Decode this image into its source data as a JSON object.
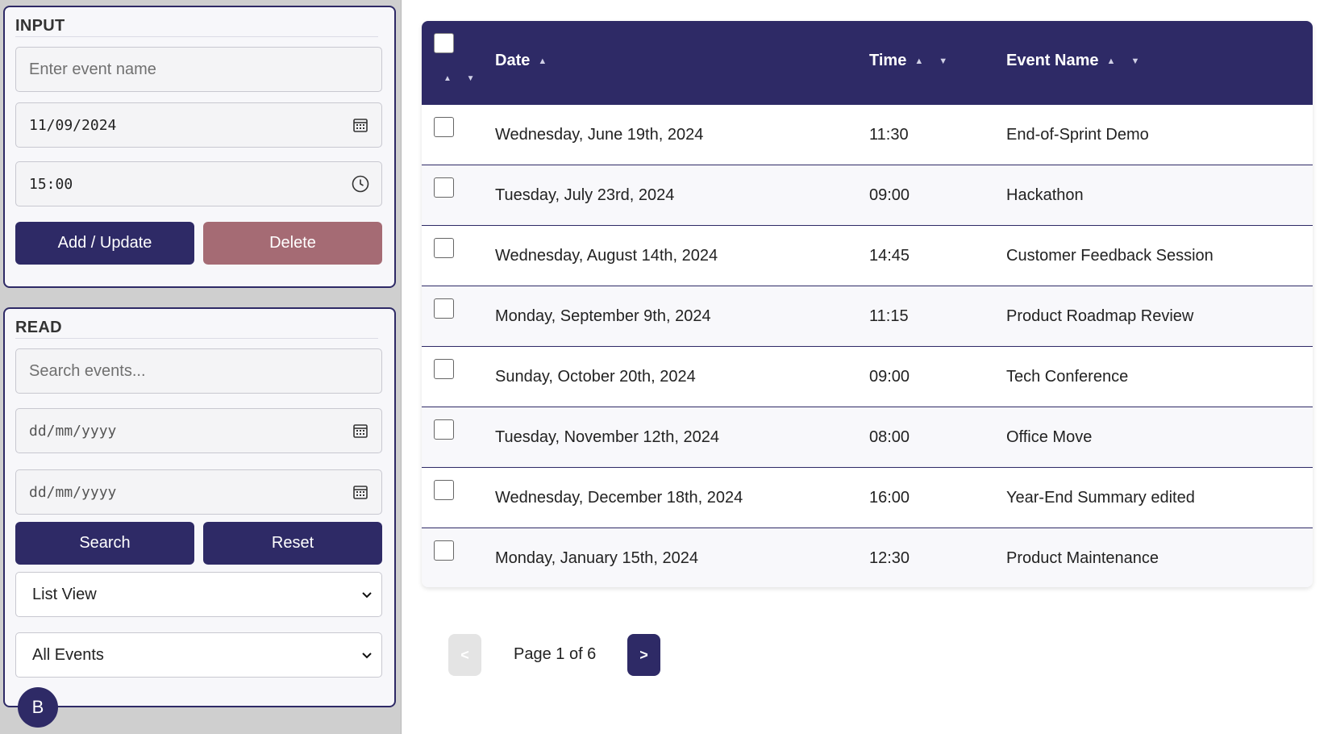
{
  "input": {
    "title": "INPUT",
    "event_name_placeholder": "Enter event name",
    "date_value": "11/09/2024",
    "time_value": "15:00",
    "add_update_label": "Add / Update",
    "delete_label": "Delete"
  },
  "read": {
    "title": "READ",
    "search_placeholder": "Search events...",
    "from_date_placeholder": "dd/mm/yyyy",
    "to_date_placeholder": "dd/mm/yyyy",
    "search_label": "Search",
    "reset_label": "Reset",
    "view_select": "List View",
    "filter_select": "All Events"
  },
  "avatar": {
    "initial": "B"
  },
  "table": {
    "columns": {
      "date": "Date",
      "time": "Time",
      "event": "Event Name"
    },
    "sort_asc": "▲",
    "sort_both": "▲ ▼",
    "rows": [
      {
        "date": "Wednesday, June 19th, 2024",
        "time": "11:30",
        "event": "End-of-Sprint Demo"
      },
      {
        "date": "Tuesday, July 23rd, 2024",
        "time": "09:00",
        "event": "Hackathon"
      },
      {
        "date": "Wednesday, August 14th, 2024",
        "time": "14:45",
        "event": "Customer Feedback Session"
      },
      {
        "date": "Monday, September 9th, 2024",
        "time": "11:15",
        "event": "Product Roadmap Review"
      },
      {
        "date": "Sunday, October 20th, 2024",
        "time": "09:00",
        "event": "Tech Conference"
      },
      {
        "date": "Tuesday, November 12th, 2024",
        "time": "08:00",
        "event": "Office Move"
      },
      {
        "date": "Wednesday, December 18th, 2024",
        "time": "16:00",
        "event": "Year-End Summary edited"
      },
      {
        "date": "Monday, January 15th, 2024",
        "time": "12:30",
        "event": "Product Maintenance"
      }
    ]
  },
  "pagination": {
    "prev": "<",
    "next": ">",
    "page_text": "Page 1 of 6"
  },
  "colors": {
    "primary": "#2e2a66",
    "danger": "#a56b74",
    "sidebar_bg": "#cfcfcf"
  }
}
